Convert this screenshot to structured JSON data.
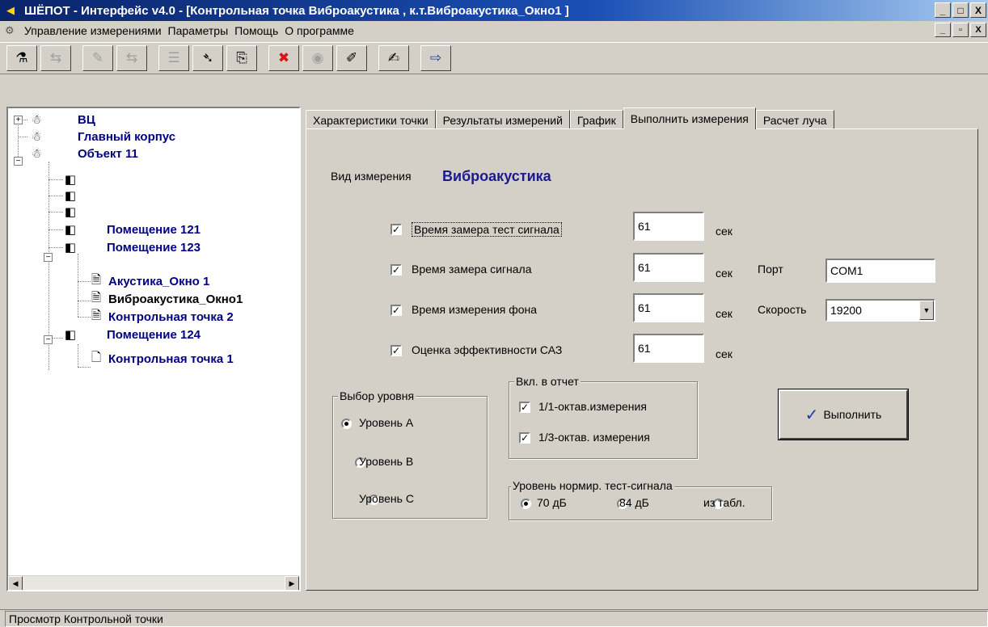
{
  "window": {
    "title": "ШЁПОТ - Интерфейс v4.0 - [Контрольная точка Виброакустика , к.т.Виброакустика_Окно1 ]",
    "buttons": {
      "minimize": "_",
      "maximize": "□",
      "close": "X"
    }
  },
  "menubar": {
    "items": [
      "Управление измерениями",
      "Параметры",
      "Помощь",
      "О программе"
    ],
    "mdi_buttons": {
      "minimize": "_",
      "restore": "▫",
      "close": "X"
    }
  },
  "toolbar": {
    "buttons": [
      {
        "icon": "person-icon",
        "glyph": "⚗",
        "enabled": true
      },
      {
        "icon": "tree-swap-icon",
        "glyph": "⇆",
        "enabled": false
      },
      {
        "icon": "pencil-icon",
        "glyph": "✎",
        "enabled": false
      },
      {
        "icon": "tree-swap-2-icon",
        "glyph": "⇆",
        "enabled": false
      },
      {
        "icon": "list-icon",
        "glyph": "☰",
        "enabled": false
      },
      {
        "icon": "signal-icon",
        "glyph": "➴",
        "enabled": true
      },
      {
        "icon": "copy-icon",
        "glyph": "⎘",
        "enabled": true
      },
      {
        "icon": "stop-icon",
        "glyph": "✖",
        "enabled": true
      },
      {
        "icon": "speaker-icon",
        "glyph": "◉",
        "enabled": false
      },
      {
        "icon": "edit-icon",
        "glyph": "✐",
        "enabled": true
      },
      {
        "icon": "draw-icon",
        "glyph": "✍",
        "enabled": true
      },
      {
        "icon": "exit-icon",
        "glyph": "⇨",
        "enabled": true
      }
    ]
  },
  "tree": {
    "nodes": [
      {
        "label": "ВЦ",
        "icon": "person-icon",
        "glyph": "☃",
        "expander": "+"
      },
      {
        "label": "Главный корпус",
        "icon": "person-icon",
        "glyph": "☃",
        "expander": ""
      },
      {
        "label": "Объект 11",
        "icon": "person-icon",
        "glyph": "☃",
        "expander": "−"
      },
      {
        "label": "",
        "icon": "room-icon",
        "glyph": "◧",
        "expander": ""
      },
      {
        "label": "",
        "icon": "room-icon",
        "glyph": "◧",
        "expander": ""
      },
      {
        "label": "",
        "icon": "room-icon",
        "glyph": "◧",
        "expander": ""
      },
      {
        "label": "Помещение 121",
        "icon": "room-icon",
        "glyph": "◧",
        "expander": ""
      },
      {
        "label": "Помещение 123",
        "icon": "room-icon",
        "glyph": "◧",
        "expander": "−"
      },
      {
        "label": "Акустика_Окно 1",
        "icon": "document-icon",
        "glyph": "🗎",
        "expander": ""
      },
      {
        "label": "Виброакустика_Окно1",
        "icon": "document-icon",
        "glyph": "🗎",
        "expander": "",
        "selected": true
      },
      {
        "label": "Контрольная точка 2",
        "icon": "document-icon",
        "glyph": "🗎",
        "expander": ""
      },
      {
        "label": "Помещение 124",
        "icon": "room-icon",
        "glyph": "◧",
        "expander": "−"
      },
      {
        "label": "Контрольная точка 1",
        "icon": "document-icon",
        "glyph": "🗋",
        "expander": ""
      }
    ],
    "scroll_left": "◀",
    "scroll_right": "▶"
  },
  "tabs": [
    "Характеристики точки",
    "Результаты измерений",
    "График",
    "Выполнить измерения",
    "Расчет луча"
  ],
  "active_tab": "Выполнить измерения",
  "form": {
    "measure_type_label": "Вид измерения",
    "measure_type_value": "Виброакустика",
    "rows": [
      {
        "label": "Время замера тест сигнала",
        "checked": true,
        "value": "61",
        "unit": "сек"
      },
      {
        "label": "Время  замера сигнала",
        "checked": true,
        "value": "61",
        "unit": "сек"
      },
      {
        "label": "Время измерения фона",
        "checked": true,
        "value": "61",
        "unit": "сек"
      },
      {
        "label": "Оценка эффективности САЗ",
        "checked": true,
        "value": "61",
        "unit": "сек"
      }
    ],
    "port_label": "Порт",
    "port_value": "COM1",
    "speed_label": "Скорость",
    "speed_value": "19200",
    "level_group": {
      "title": "Выбор уровня",
      "options": [
        "Уровень А",
        "Уровень В",
        "Уровень С"
      ],
      "selected": 0
    },
    "report_group": {
      "title": "Вкл. в отчет",
      "options": [
        {
          "label": "1/1-октав.измерения",
          "checked": true
        },
        {
          "label": "1/3-октав. измерения",
          "checked": true
        }
      ]
    },
    "norm_group": {
      "title": "Уровень нормир. тест-сигнала",
      "options": [
        "70 дБ",
        "84 дБ",
        "из табл."
      ],
      "selected": 0
    },
    "execute_label": "Выполнить",
    "check_glyph": "✓",
    "dropdown_glyph": "▼",
    "accent_color": "#1a1a8c"
  },
  "statusbar": {
    "text": "Просмотр Контрольной точки"
  }
}
